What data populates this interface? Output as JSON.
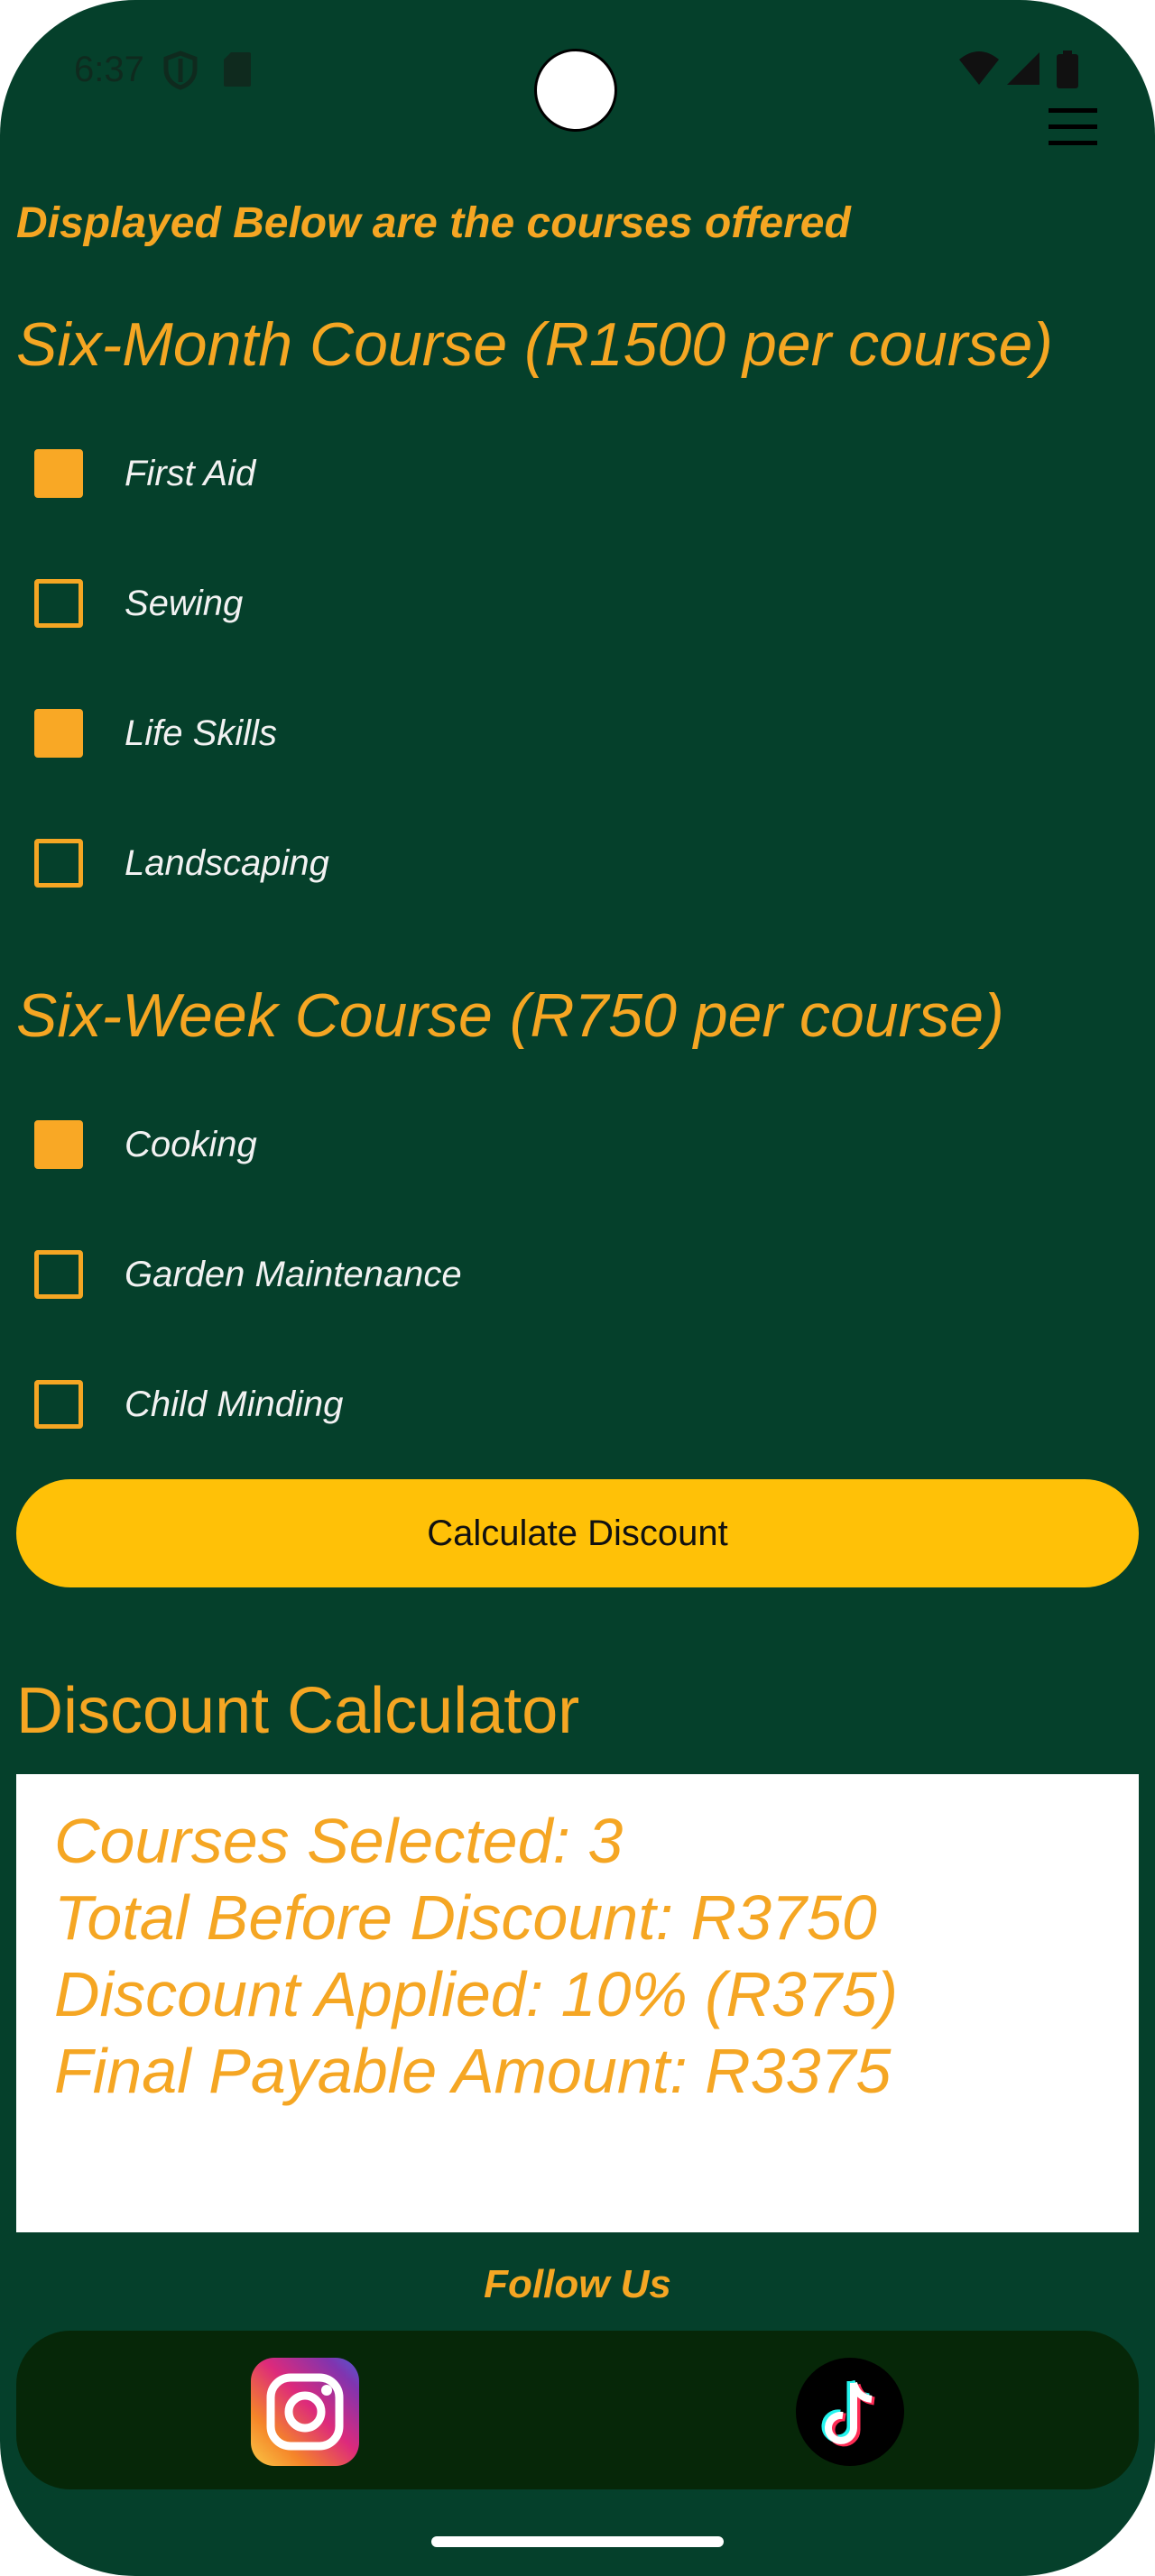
{
  "status_bar": {
    "time": "6:37"
  },
  "header": {
    "intro_text": "Displayed Below are the courses offered"
  },
  "six_month": {
    "heading": "Six-Month Course (R1500 per course)",
    "courses": [
      {
        "label": "First Aid",
        "checked": true
      },
      {
        "label": "Sewing",
        "checked": false
      },
      {
        "label": "Life Skills",
        "checked": true
      },
      {
        "label": "Landscaping",
        "checked": false
      }
    ]
  },
  "six_week": {
    "heading": "Six-Week Course (R750 per course)",
    "courses": [
      {
        "label": "Cooking",
        "checked": true
      },
      {
        "label": "Garden Maintenance",
        "checked": false
      },
      {
        "label": "Child Minding",
        "checked": false
      }
    ]
  },
  "calculate_button_label": "Calculate Discount",
  "calculator": {
    "title": "Discount Calculator",
    "lines": [
      "Courses Selected: 3",
      "Total Before Discount: R3750",
      "Discount Applied: 10% (R375)",
      "Final Payable Amount: R3375"
    ]
  },
  "footer": {
    "follow_label": "Follow Us",
    "social": [
      "instagram-icon",
      "tiktok-icon"
    ]
  },
  "colors": {
    "background": "#05402b",
    "accent": "#f5a623",
    "button": "#ffc107",
    "social_bar": "#062708"
  }
}
